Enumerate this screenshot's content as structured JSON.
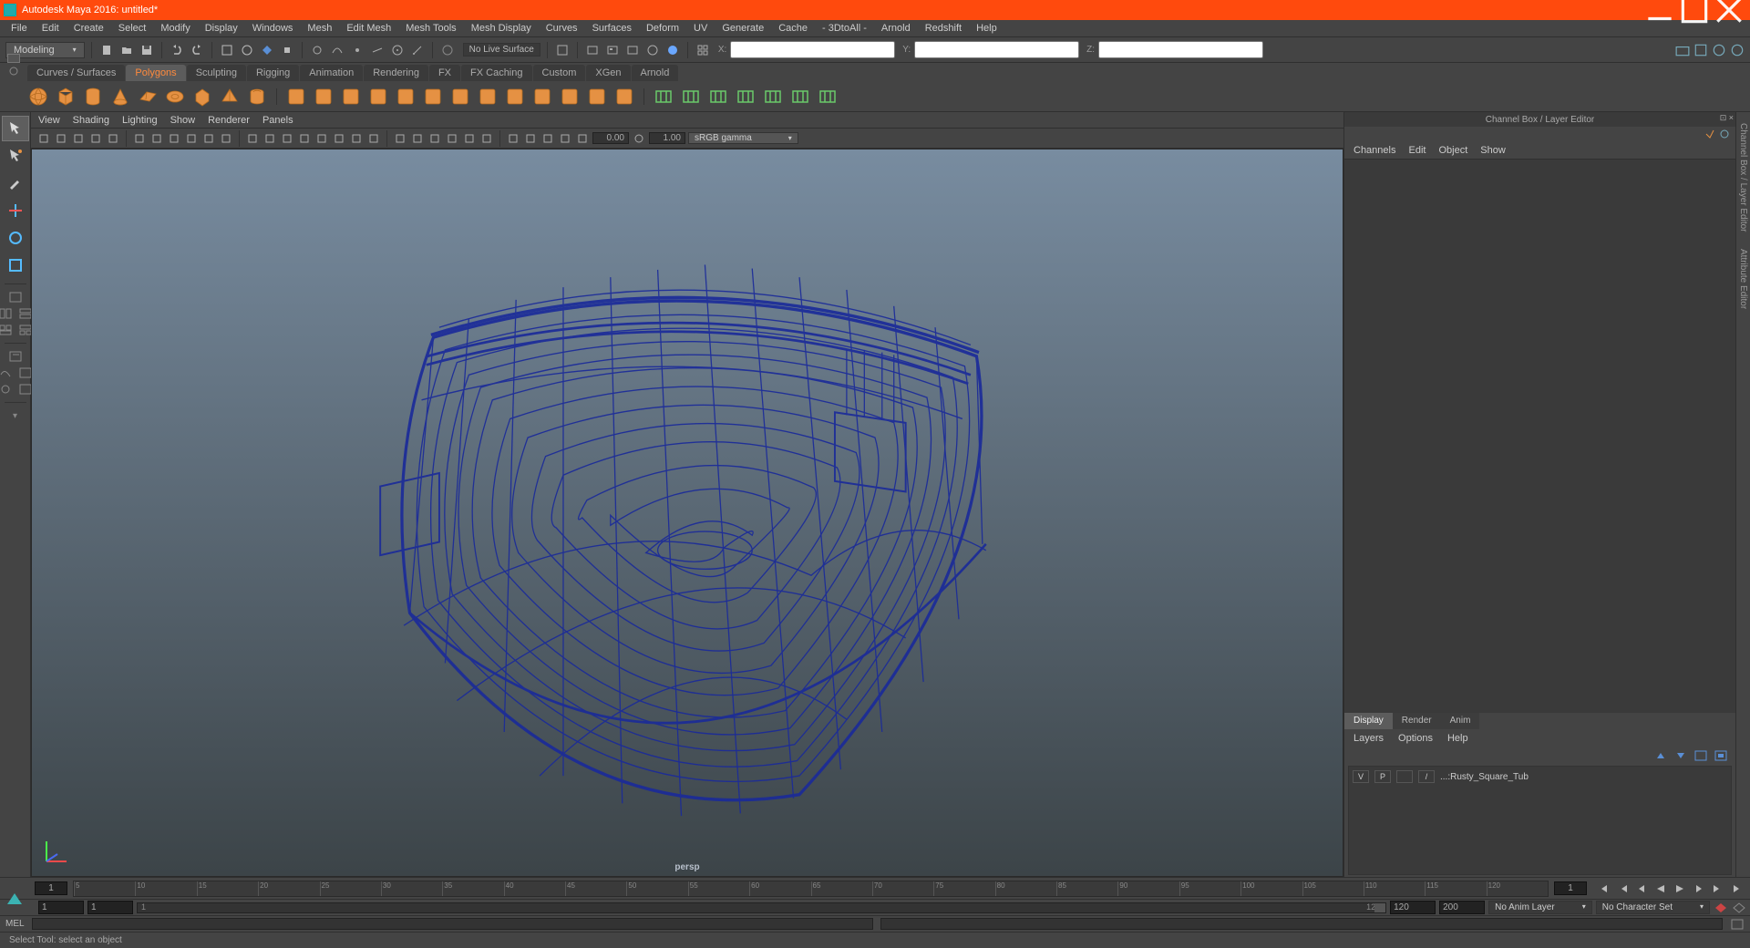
{
  "title": "Autodesk Maya 2016: untitled*",
  "menubar": [
    "File",
    "Edit",
    "Create",
    "Select",
    "Modify",
    "Display",
    "Windows",
    "Mesh",
    "Edit Mesh",
    "Mesh Tools",
    "Mesh Display",
    "Curves",
    "Surfaces",
    "Deform",
    "UV",
    "Generate",
    "Cache",
    "- 3DtoAll -",
    "Arnold",
    "Redshift",
    "Help"
  ],
  "workspace": "Modeling",
  "live_surface": "No Live Surface",
  "coord_labels": {
    "x": "X:",
    "y": "Y:",
    "z": "Z:"
  },
  "shelf_tabs": [
    "Curves / Surfaces",
    "Polygons",
    "Sculpting",
    "Rigging",
    "Animation",
    "Rendering",
    "FX",
    "FX Caching",
    "Custom",
    "XGen",
    "Arnold"
  ],
  "shelf_active": "Polygons",
  "view_menubar": [
    "View",
    "Shading",
    "Lighting",
    "Show",
    "Renderer",
    "Panels"
  ],
  "view_numbers": {
    "a": "0.00",
    "b": "1.00"
  },
  "colorspace": "sRGB gamma",
  "camera": "persp",
  "channelbox": {
    "title": "Channel Box / Layer Editor",
    "menu": [
      "Channels",
      "Edit",
      "Object",
      "Show"
    ]
  },
  "layer_tabs": [
    "Display",
    "Render",
    "Anim"
  ],
  "layer_menubar": [
    "Layers",
    "Options",
    "Help"
  ],
  "layer_row": {
    "v": "V",
    "p": "P",
    "slash": "/",
    "name": "...:Rusty_Square_Tub"
  },
  "right_rail": [
    "Channel Box / Layer Editor",
    "Attribute Editor"
  ],
  "timeline": {
    "start": "1",
    "end": "1",
    "ticks": [
      "5",
      "10",
      "15",
      "20",
      "25",
      "30",
      "35",
      "40",
      "45",
      "50",
      "55",
      "60",
      "65",
      "70",
      "75",
      "80",
      "85",
      "90",
      "95",
      "100",
      "105",
      "110",
      "115",
      "120"
    ]
  },
  "range": {
    "a": "1",
    "b": "1",
    "c": "120",
    "d": "120",
    "e": "200",
    "anim": "No Anim Layer",
    "char": "No Character Set"
  },
  "cmd": {
    "label": "MEL"
  },
  "status": "Select Tool: select an object"
}
